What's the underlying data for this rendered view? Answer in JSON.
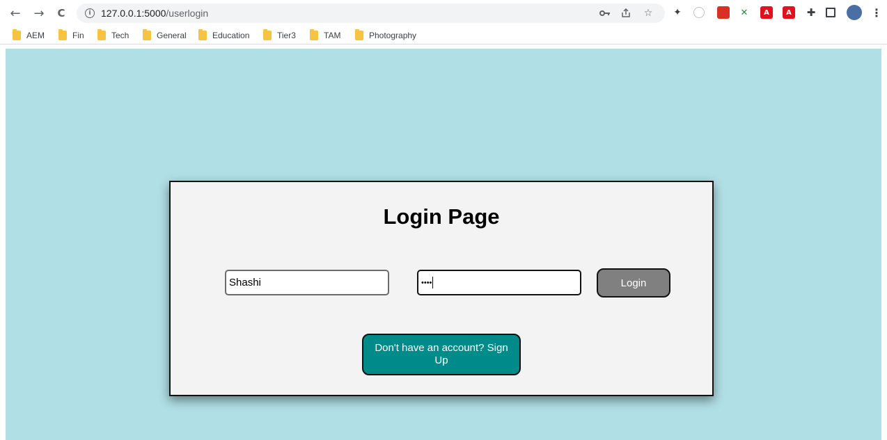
{
  "browser": {
    "back_icon": "←",
    "forward_icon": "→",
    "reload_icon": "C",
    "url_host": "127.0.0.1:5000",
    "url_path": "/userlogin",
    "toolbar_icons": [
      "key-icon",
      "share-icon",
      "star-icon"
    ],
    "extensions": [
      {
        "name": "turtle-extension-icon",
        "color": "#3c4043"
      },
      {
        "name": "circle-extension-icon",
        "color": "#dadce0"
      },
      {
        "name": "red-square-extension-icon",
        "color": "#d93025"
      },
      {
        "name": "green-extension-icon",
        "color": "#1e8e3e"
      },
      {
        "name": "adobe-extension-icon",
        "color": "#e3101e"
      },
      {
        "name": "adobe-acrobat-extension-icon",
        "color": "#e3101e"
      },
      {
        "name": "puzzle-icon",
        "color": "#3c4043"
      },
      {
        "name": "side-panel-icon",
        "color": "#3c4043"
      },
      {
        "name": "profile-avatar",
        "color": "#4a6fa5"
      },
      {
        "name": "menu-icon",
        "color": "#3c4043"
      }
    ]
  },
  "bookmarks": [
    "AEM",
    "Fin",
    "Tech",
    "General",
    "Education",
    "Tier3",
    "TAM",
    "Photography"
  ],
  "login": {
    "title": "Login Page",
    "username_value": "Shashi",
    "password_value": "••••",
    "login_label": "Login",
    "signup_label": "Don't have an account? Sign Up"
  },
  "colors": {
    "page_bg": "#b0dfe5",
    "card_bg": "#f3f3f3",
    "login_btn": "#808080",
    "signup_btn": "#008b8b"
  }
}
